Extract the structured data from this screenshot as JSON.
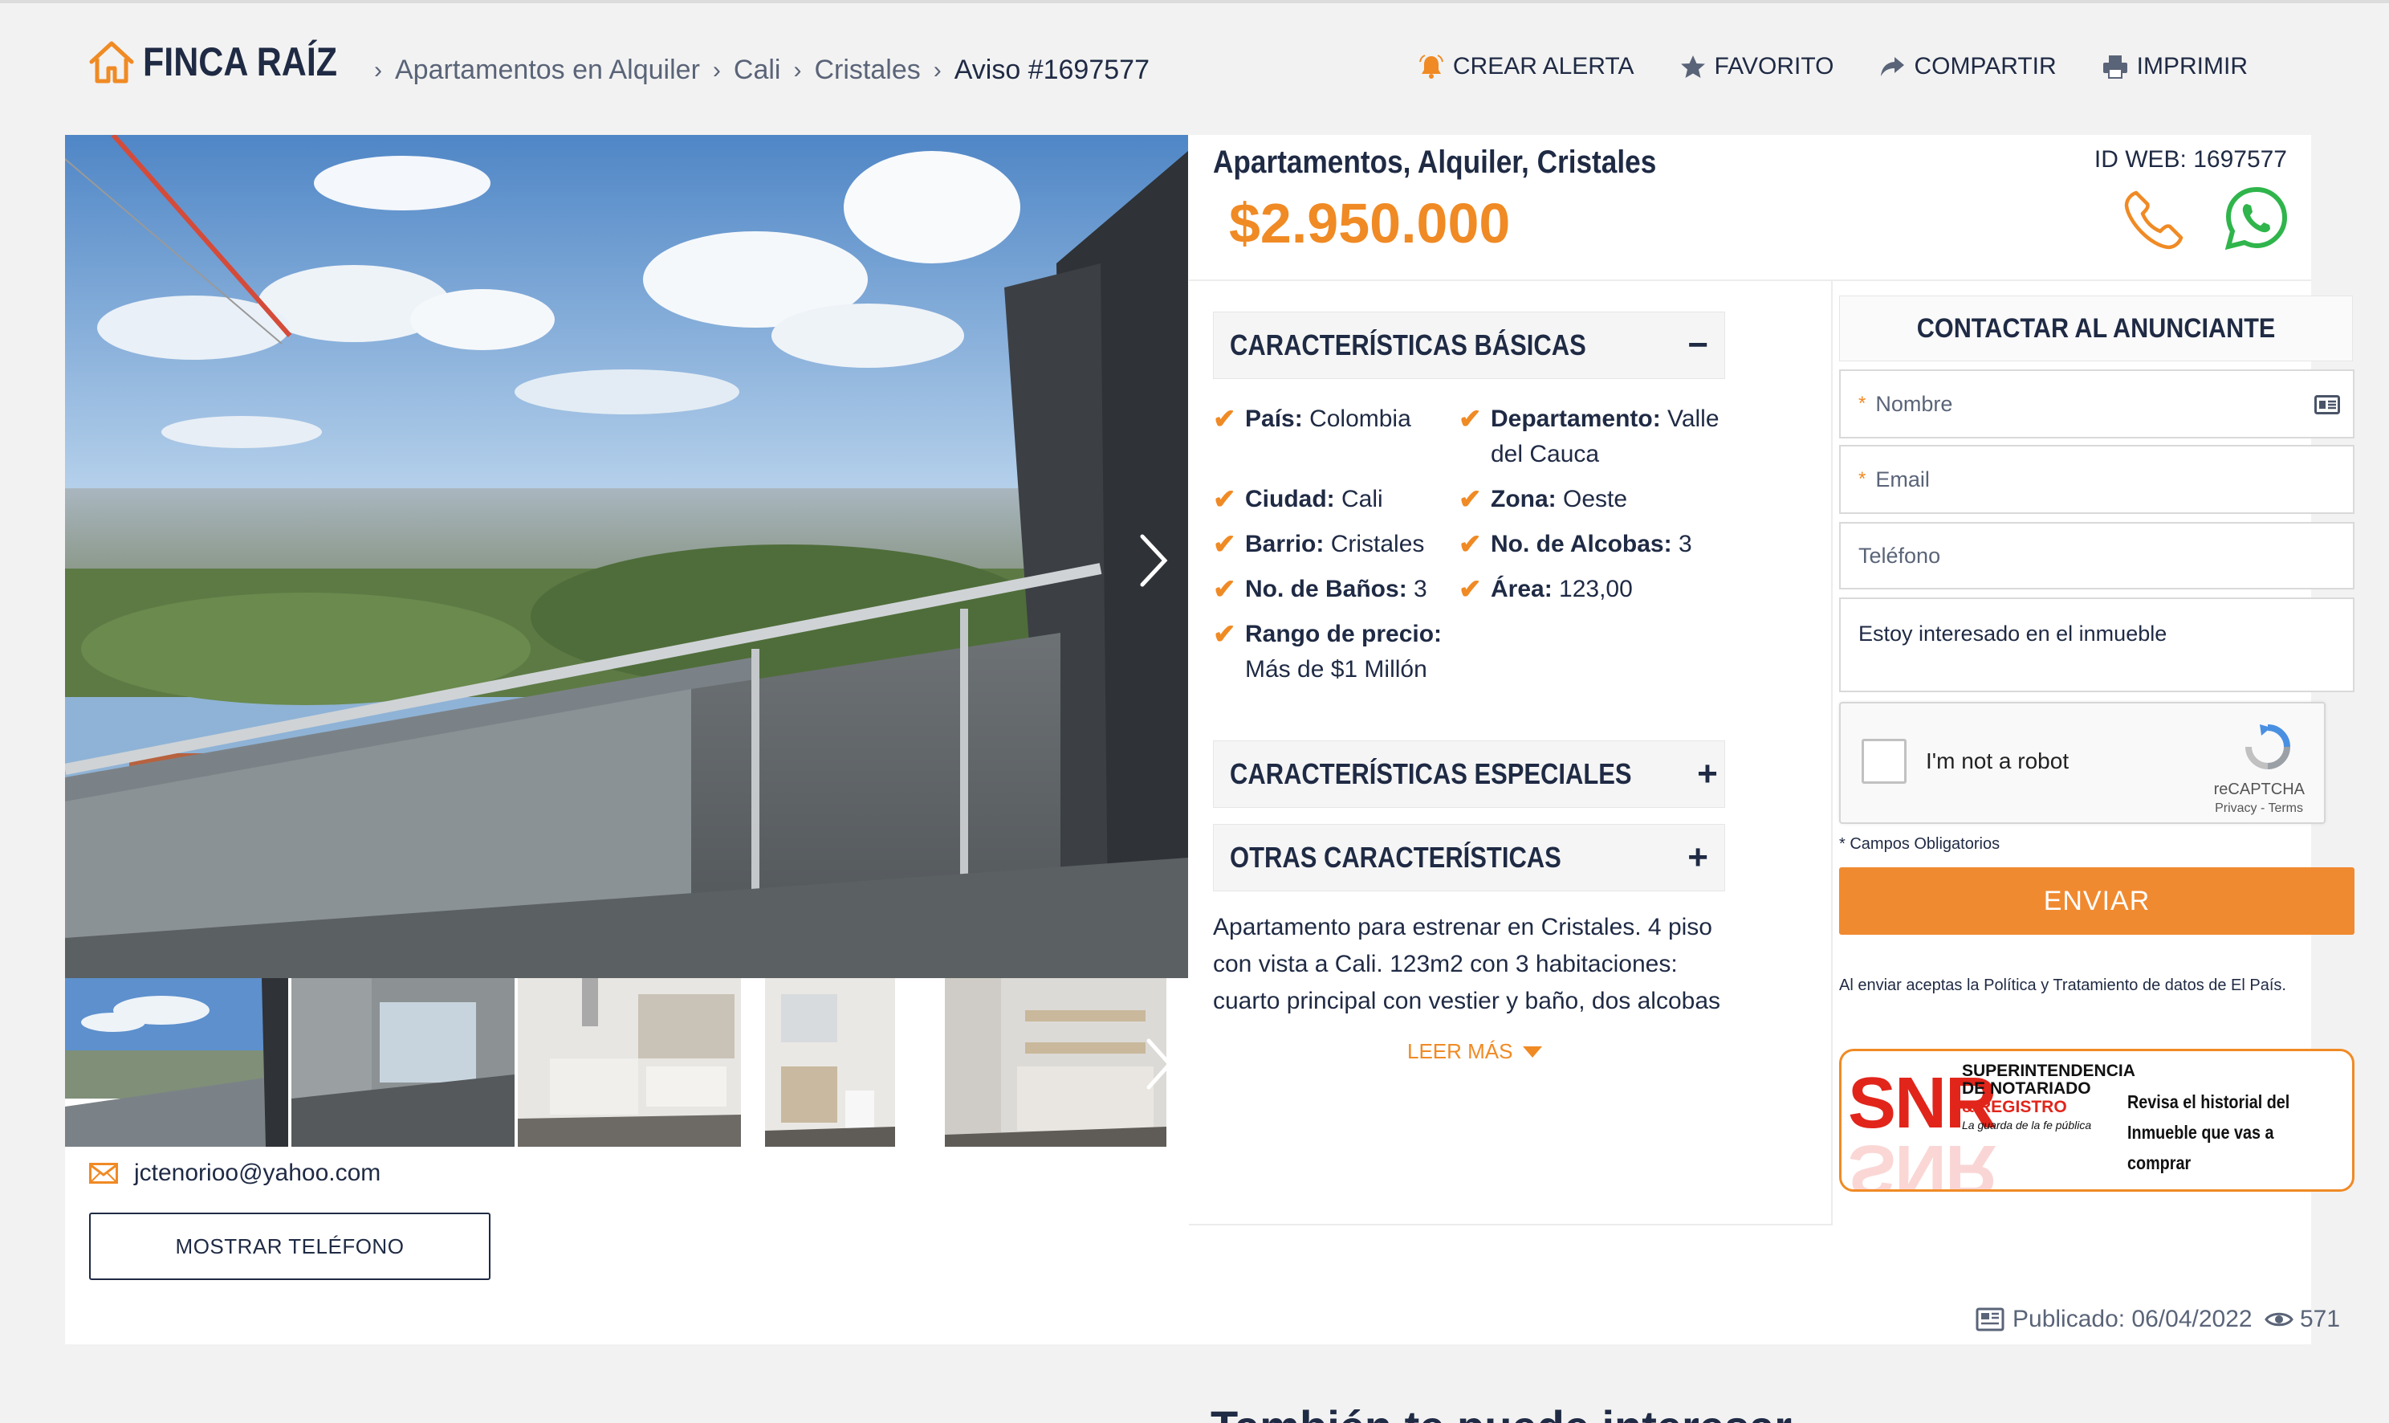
{
  "header": {
    "logo_text": "FINCA RAÍZ",
    "breadcrumbs": [
      "Apartamentos en Alquiler",
      "Cali",
      "Cristales",
      "Aviso #1697577"
    ],
    "breadcrumb_separator": "›",
    "actions": {
      "alert": "CREAR ALERTA",
      "favorite": "FAVORITO",
      "share": "COMPARTIR",
      "print": "IMPRIMIR"
    }
  },
  "listing": {
    "title": "Apartamentos, Alquiler, Cristales",
    "price": "$2.950.000",
    "id_web": "ID WEB: 1697577",
    "email": "jctenorioo@yahoo.com",
    "show_phone": "MOSTRAR TELÉFONO",
    "published": "Publicado: 06/04/2022",
    "views": "571"
  },
  "sections": {
    "basic": {
      "title": "CARACTERÍSTICAS BÁSICAS",
      "toggle": "−",
      "features": [
        {
          "label": "País:",
          "value": "Colombia"
        },
        {
          "label": "Departamento:",
          "value": "Valle del Cauca"
        },
        {
          "label": "Ciudad:",
          "value": "Cali"
        },
        {
          "label": "Zona:",
          "value": "Oeste"
        },
        {
          "label": "Barrio:",
          "value": "Cristales"
        },
        {
          "label": "No. de Alcobas:",
          "value": "3"
        },
        {
          "label": "No. de Baños:",
          "value": "3"
        },
        {
          "label": "Área:",
          "value": "123,00"
        },
        {
          "label": "Rango de precio:",
          "value": "Más de $1 Millón"
        }
      ]
    },
    "special": {
      "title": "CARACTERÍSTICAS ESPECIALES",
      "toggle": "+"
    },
    "other": {
      "title": "OTRAS CARACTERÍSTICAS",
      "toggle": "+"
    }
  },
  "description": {
    "text": "Apartamento para estrenar en Cristales. 4 piso con vista a Cali. 123m2 con 3 habitaciones: cuarto principal con vestier y baño, dos alcobas que",
    "read_more": "LEER MÁS"
  },
  "form": {
    "title": "CONTACTAR AL ANUNCIANTE",
    "name_placeholder": "Nombre",
    "email_placeholder": "Email",
    "phone_placeholder": "Teléfono",
    "message": "Estoy interesado en el inmueble",
    "required_mark": "*",
    "captcha_label": "I'm not a robot",
    "captcha_brand": "reCAPTCHA",
    "captcha_links": "Privacy - Terms",
    "required_note": "* Campos Obligatorios",
    "submit": "ENVIAR",
    "policy": "Al enviar aceptas la Política y Tratamiento de datos de El País."
  },
  "snr_banner": {
    "logo": "SNR",
    "line1": "SUPERINTENDENCIA",
    "line2": "DE NOTARIADO",
    "line3": "& REGISTRO",
    "tagline": "La guarda de la fe pública",
    "side1": "Revisa el historial del",
    "side2": "Inmueble que vas a comprar"
  },
  "below": {
    "heading": "También te puede interesar"
  },
  "colors": {
    "accent": "#f08a24",
    "navy": "#1f2a44",
    "whatsapp": "#2fb54b",
    "snr_red": "#e1251b"
  }
}
